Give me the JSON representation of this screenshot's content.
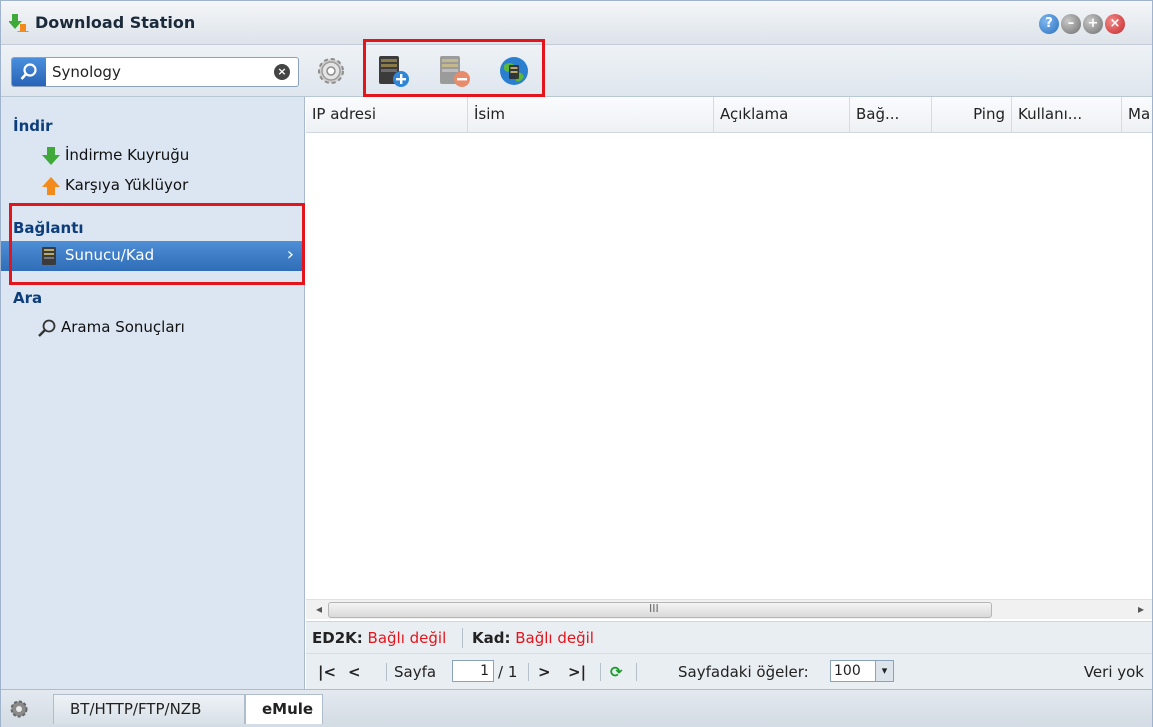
{
  "window": {
    "title": "Download Station"
  },
  "toolbar": {
    "search_value": "Synology"
  },
  "sidebar": {
    "groups": [
      {
        "heading": "İndir",
        "items": [
          {
            "label": "İndirme Kuyruğu",
            "icon": "download-arrow-icon"
          },
          {
            "label": "Karşıya Yüklüyor",
            "icon": "upload-arrow-icon"
          }
        ]
      },
      {
        "heading": "Bağlantı",
        "items": [
          {
            "label": "Sunucu/Kad",
            "icon": "server-icon",
            "active": true
          }
        ]
      },
      {
        "heading": "Ara",
        "items": [
          {
            "label": "Arama Sonuçları",
            "icon": "search-icon"
          }
        ]
      }
    ]
  },
  "grid": {
    "columns": [
      "IP adresi",
      "İsim",
      "Açıklama",
      "Bağ...",
      "Ping",
      "Kullanı...",
      "Ma"
    ],
    "rows": []
  },
  "status": {
    "ed2k_label": "ED2K:",
    "ed2k_value": "Bağlı değil",
    "kad_label": "Kad:",
    "kad_value": "Bağlı değil"
  },
  "pager": {
    "page_label": "Sayfa",
    "page_value": "1",
    "page_total": "/ 1",
    "items_label": "Sayfadaki öğeler:",
    "items_value": "100",
    "empty_text": "Veri yok"
  },
  "tabs": [
    {
      "label": "BT/HTTP/FTP/NZB",
      "active": false
    },
    {
      "label": "eMule",
      "active": true
    }
  ],
  "colors": {
    "accent": "#2f6db8",
    "highlight_border": "#e3141b",
    "status_error": "#e3141b",
    "sidebar_bg": "#dbe6f2"
  }
}
